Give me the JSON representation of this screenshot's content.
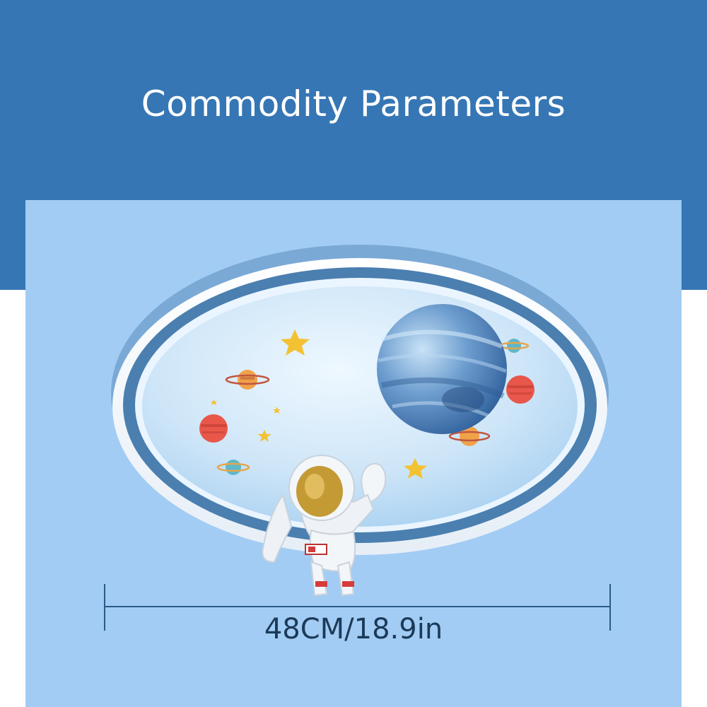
{
  "header": {
    "title": "Commodity Parameters"
  },
  "dimension": {
    "label": "48CM/18.9in"
  },
  "colors": {
    "header_band": "#3676b4",
    "panel": "#a2ccf4",
    "lamp_rim": "#4a7fb0",
    "lamp_face": "#d6ebfa",
    "planet": "#4f86bf",
    "star": "#f3c233",
    "dimension_line": "#2b5a86"
  },
  "product": {
    "icons": [
      "ceiling-lamp",
      "planet-icon",
      "star-icon",
      "astronaut-figure"
    ]
  }
}
